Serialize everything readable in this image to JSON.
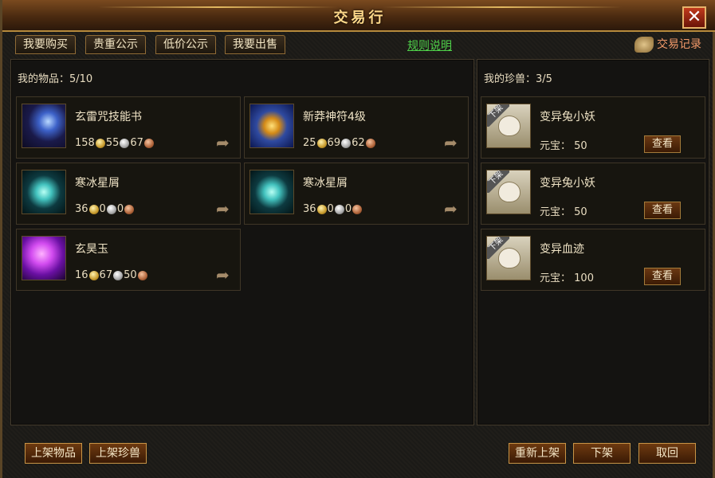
{
  "window": {
    "title": "交易行",
    "close_symbol": "✕"
  },
  "tabs": [
    {
      "label": "我要购买"
    },
    {
      "label": "贵重公示"
    },
    {
      "label": "低价公示"
    },
    {
      "label": "我要出售"
    }
  ],
  "rules_link": "规则说明",
  "trade_record": "交易记录",
  "items_panel": {
    "header": "我的物品：5/10",
    "items": [
      {
        "name": "玄雷咒技能书",
        "gold": "158",
        "silver": "55",
        "copper": "67",
        "icon": "thunder-skillbook-icon"
      },
      {
        "name": "新莽神符4级",
        "gold": "25",
        "silver": "69",
        "copper": "62",
        "icon": "rune-talisman-icon"
      },
      {
        "name": "寒冰星屑",
        "gold": "36",
        "silver": "0",
        "copper": "0",
        "icon": "ice-stardust-icon"
      },
      {
        "name": "寒冰星屑",
        "gold": "36",
        "silver": "0",
        "copper": "0",
        "icon": "ice-stardust-icon"
      },
      {
        "name": "玄昊玉",
        "gold": "16",
        "silver": "67",
        "copper": "50",
        "icon": "purple-jade-icon"
      }
    ]
  },
  "pets_panel": {
    "header": "我的珍兽：3/5",
    "pets": [
      {
        "name": "变异兔小妖",
        "price_label": "元宝：",
        "price": "50",
        "stamp": "下架",
        "view": "查看"
      },
      {
        "name": "变异兔小妖",
        "price_label": "元宝：",
        "price": "50",
        "stamp": "下架",
        "view": "查看"
      },
      {
        "name": "变异血迹",
        "price_label": "元宝：",
        "price": "100",
        "stamp": "下架",
        "view": "查看"
      }
    ]
  },
  "buttons": {
    "list_item": "上架物品",
    "list_pet": "上架珍兽",
    "relist": "重新上架",
    "delist": "下架",
    "cancel": "取回"
  },
  "colors": {
    "accent": "#ffd98a",
    "link": "#4fd24a",
    "record": "#f39a6a"
  }
}
